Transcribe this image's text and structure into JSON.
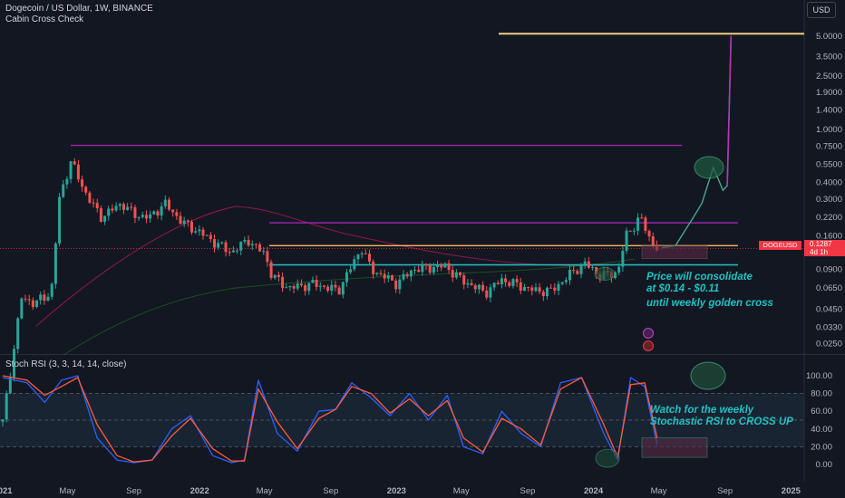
{
  "header": {
    "title": "Dogecoin / US Dollar, 1W, BINANCE",
    "indicator": "Cabin Cross Check",
    "currency_button": "USD"
  },
  "price_tag": {
    "symbol": "DOGEUSD",
    "price": "0.1287",
    "countdown": "4d 1h"
  },
  "annotations": {
    "consolidate": "Price will consolidate\nat $0.14 - $0.11",
    "golden_cross": "until weekly golden cross",
    "rsi_note": "Watch for the weekly\nStochastic RSI to CROSS UP"
  },
  "colors": {
    "background": "#131722",
    "candle_up": "#26a69a",
    "candle_down": "#ef5350",
    "stoch_k": "#2962ff",
    "stoch_d": "#ff5b3a",
    "annotation": "#22c1c3",
    "resistance_purple": "#9c27b0",
    "support_orange": "#ffb74d",
    "target_yellow": "#f0d080"
  },
  "chart_data": [
    {
      "type": "candlestick",
      "title": "Dogecoin / US Dollar, 1W, BINANCE",
      "y_scale": "log",
      "y_ticks": [
        "5.0000",
        "3.5000",
        "2.5000",
        "1.9000",
        "1.4000",
        "1.0000",
        "0.7500",
        "0.5500",
        "0.4000",
        "0.3000",
        "0.2200",
        "0.1600",
        "0.1200",
        "0.0900",
        "0.0650",
        "0.0450",
        "0.0330",
        "0.0250"
      ],
      "x_ticks": [
        "2021",
        "May",
        "Sep",
        "2022",
        "May",
        "Sep",
        "2023",
        "May",
        "Sep",
        "2024",
        "May",
        "Sep",
        "2025"
      ],
      "close_series": [
        [
          "2021-01-01",
          0.0065
        ],
        [
          "2021-02-05",
          0.055
        ],
        [
          "2021-03-01",
          0.05
        ],
        [
          "2021-04-01",
          0.06
        ],
        [
          "2021-04-16",
          0.3
        ],
        [
          "2021-05-07",
          0.58
        ],
        [
          "2021-06-01",
          0.35
        ],
        [
          "2021-07-01",
          0.22
        ],
        [
          "2021-08-10",
          0.28
        ],
        [
          "2021-09-01",
          0.23
        ],
        [
          "2021-10-01",
          0.22
        ],
        [
          "2021-10-28",
          0.28
        ],
        [
          "2021-12-01",
          0.2
        ],
        [
          "2022-01-01",
          0.17
        ],
        [
          "2022-02-01",
          0.14
        ],
        [
          "2022-03-01",
          0.12
        ],
        [
          "2022-04-01",
          0.15
        ],
        [
          "2022-04-15",
          0.13
        ],
        [
          "2022-05-01",
          0.12
        ],
        [
          "2022-05-15",
          0.08
        ],
        [
          "2022-06-15",
          0.065
        ],
        [
          "2022-08-01",
          0.07
        ],
        [
          "2022-09-15",
          0.062
        ],
        [
          "2022-10-28",
          0.13
        ],
        [
          "2022-11-15",
          0.09
        ],
        [
          "2023-01-01",
          0.07
        ],
        [
          "2023-02-01",
          0.09
        ],
        [
          "2023-04-01",
          0.095
        ],
        [
          "2023-05-01",
          0.075
        ],
        [
          "2023-06-15",
          0.06
        ],
        [
          "2023-07-15",
          0.075
        ],
        [
          "2023-09-15",
          0.062
        ],
        [
          "2023-10-15",
          0.062
        ],
        [
          "2023-11-15",
          0.08
        ],
        [
          "2023-12-15",
          0.1
        ],
        [
          "2024-01-15",
          0.08
        ],
        [
          "2024-02-15",
          0.085
        ],
        [
          "2024-03-01",
          0.16
        ],
        [
          "2024-03-28",
          0.22
        ],
        [
          "2024-04-15",
          0.15
        ],
        [
          "2024-04-28",
          0.1287
        ]
      ],
      "projection": [
        [
          "2024-05-07",
          0.13
        ],
        [
          "2024-06-01",
          0.135
        ],
        [
          "2024-07-01",
          0.21
        ],
        [
          "2024-07-20",
          0.28
        ],
        [
          "2024-08-10",
          0.52
        ],
        [
          "2024-08-28",
          0.35
        ],
        [
          "2024-09-05",
          0.38
        ],
        [
          "2024-09-12",
          5.0
        ]
      ],
      "levels": [
        {
          "price": 0.76,
          "color": "resistance_purple"
        },
        {
          "price": 0.2,
          "color": "resistance_purple"
        },
        {
          "price": 0.135,
          "color": "support_orange"
        },
        {
          "price": 0.097,
          "color": "annotation"
        },
        {
          "price": 5.2,
          "color": "target_yellow"
        }
      ]
    },
    {
      "type": "line",
      "title": "Stoch RSI (3, 3, 14, 14, close)",
      "ylim": [
        0,
        100
      ],
      "y_ticks": [
        "100.00",
        "80.00",
        "60.00",
        "40.00",
        "20.00",
        "0.00"
      ],
      "series": [
        {
          "color": "stoch_k",
          "x": [
            "2021-01-01",
            "2021-02-15",
            "2021-03-20",
            "2021-04-20",
            "2021-05-20",
            "2021-06-25",
            "2021-08-01",
            "2021-09-01",
            "2021-10-05",
            "2021-11-10",
            "2021-12-15",
            "2022-01-25",
            "2022-03-01",
            "2022-03-25",
            "2022-04-20",
            "2022-05-25",
            "2022-07-01",
            "2022-08-10",
            "2022-09-10",
            "2022-10-10",
            "2022-11-15",
            "2022-12-20",
            "2023-01-25",
            "2023-03-01",
            "2023-04-05",
            "2023-05-05",
            "2023-06-10",
            "2023-07-15",
            "2023-08-20",
            "2023-09-25",
            "2023-11-01",
            "2023-12-10",
            "2024-01-20",
            "2024-02-15",
            "2024-03-10",
            "2024-04-05",
            "2024-04-28"
          ],
          "values": [
            98,
            92,
            70,
            95,
            100,
            30,
            5,
            2,
            5,
            40,
            55,
            10,
            2,
            5,
            95,
            35,
            15,
            60,
            62,
            92,
            75,
            55,
            80,
            50,
            78,
            20,
            12,
            60,
            35,
            20,
            92,
            98,
            35,
            5,
            98,
            88,
            22
          ]
        },
        {
          "color": "stoch_d",
          "x": [
            "2021-01-01",
            "2021-02-15",
            "2021-03-20",
            "2021-04-20",
            "2021-05-20",
            "2021-06-25",
            "2021-08-01",
            "2021-09-01",
            "2021-10-05",
            "2021-11-10",
            "2021-12-15",
            "2022-01-25",
            "2022-03-01",
            "2022-03-25",
            "2022-04-20",
            "2022-05-25",
            "2022-07-01",
            "2022-08-10",
            "2022-09-10",
            "2022-10-10",
            "2022-11-15",
            "2022-12-20",
            "2023-01-25",
            "2023-03-01",
            "2023-04-05",
            "2023-05-05",
            "2023-06-10",
            "2023-07-15",
            "2023-08-20",
            "2023-09-25",
            "2023-11-01",
            "2023-12-10",
            "2024-01-20",
            "2024-02-15",
            "2024-03-10",
            "2024-04-05",
            "2024-04-28"
          ],
          "values": [
            100,
            95,
            78,
            88,
            98,
            45,
            10,
            3,
            5,
            32,
            52,
            18,
            4,
            4,
            85,
            48,
            18,
            52,
            62,
            88,
            80,
            58,
            74,
            55,
            72,
            30,
            14,
            52,
            40,
            22,
            85,
            98,
            45,
            8,
            90,
            92,
            30
          ]
        }
      ]
    }
  ]
}
